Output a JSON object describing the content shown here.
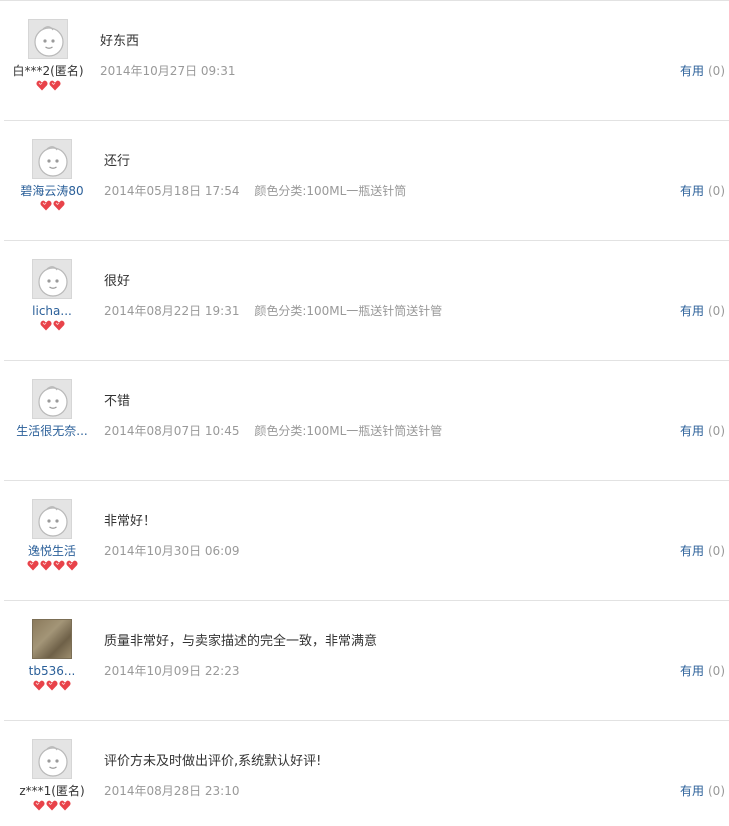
{
  "reviews": [
    {
      "username": "白***2(匿名)",
      "username_style": "anon",
      "avatar": "default-avatar-icon",
      "rank_hearts": 2,
      "comment": "好东西",
      "date": "2014年10月27日 09:31",
      "sku": "",
      "useful_label": "有用",
      "useful_count": "(0)"
    },
    {
      "username": "碧海云涛80",
      "username_style": "link",
      "avatar": "default-avatar-icon",
      "rank_hearts": 2,
      "comment": "还行",
      "date": "2014年05月18日 17:54",
      "sku": "颜色分类:100ML一瓶送针筒",
      "useful_label": "有用",
      "useful_count": "(0)"
    },
    {
      "username": "licha...",
      "username_style": "link",
      "avatar": "default-avatar-icon",
      "rank_hearts": 2,
      "comment": "很好",
      "date": "2014年08月22日 19:31",
      "sku": "颜色分类:100ML一瓶送针筒送针管",
      "useful_label": "有用",
      "useful_count": "(0)"
    },
    {
      "username": "生活很无奈...",
      "username_style": "link",
      "avatar": "default-avatar-icon",
      "rank_hearts": 0,
      "comment": "不错",
      "date": "2014年08月07日 10:45",
      "sku": "颜色分类:100ML一瓶送针筒送针管",
      "useful_label": "有用",
      "useful_count": "(0)"
    },
    {
      "username": "逸悦生活",
      "username_style": "link",
      "avatar": "default-avatar-icon",
      "rank_hearts": 4,
      "comment": "非常好！",
      "date": "2014年10月30日 06:09",
      "sku": "",
      "useful_label": "有用",
      "useful_count": "(0)"
    },
    {
      "username": "tb536...",
      "username_style": "link",
      "avatar": "user-photo-avatar",
      "rank_hearts": 3,
      "comment": "质量非常好，与卖家描述的完全一致，非常满意",
      "date": "2014年10月09日 22:23",
      "sku": "",
      "useful_label": "有用",
      "useful_count": "(0)"
    },
    {
      "username": "z***1(匿名)",
      "username_style": "anon",
      "avatar": "default-avatar-icon",
      "rank_hearts": 3,
      "comment": "评价方未及时做出评价,系统默认好评!",
      "date": "2014年08月28日 23:10",
      "sku": "",
      "useful_label": "有用",
      "useful_count": "(0)"
    }
  ],
  "colors": {
    "link": "#2a5f99",
    "muted": "#999999",
    "heart": "#e8434a",
    "divider": "#e2e2e2"
  }
}
